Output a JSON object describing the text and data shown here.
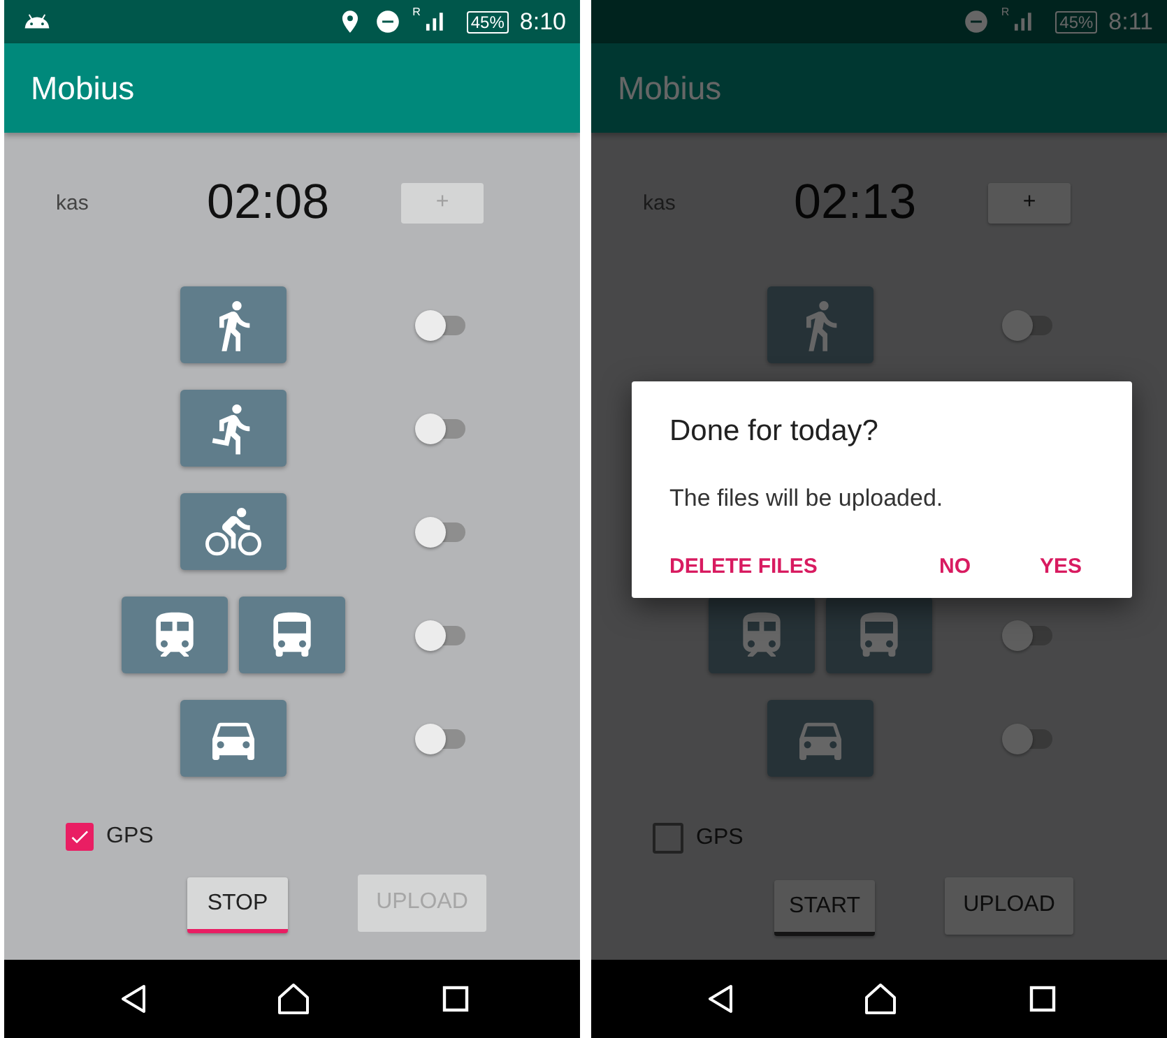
{
  "screens": [
    {
      "status_bar": {
        "left_icons": [
          {
            "kind": "android"
          }
        ],
        "right_icons": [
          {
            "kind": "location"
          },
          {
            "kind": "dnd"
          }
        ],
        "roaming": "R",
        "battery": "45%",
        "time": "8:10"
      },
      "app_title": "Mobius",
      "name_label": "kas",
      "timer": "02:08",
      "plus_button": {
        "label": "+",
        "disabled": true
      },
      "modes": [
        {
          "icons": [
            {
              "kind": "walk"
            }
          ],
          "on": false
        },
        {
          "icons": [
            {
              "kind": "run"
            }
          ],
          "on": false
        },
        {
          "icons": [
            {
              "kind": "bike"
            }
          ],
          "on": false
        },
        {
          "icons": [
            {
              "kind": "train"
            },
            {
              "kind": "bus"
            }
          ],
          "on": false
        },
        {
          "icons": [
            {
              "kind": "car"
            }
          ],
          "on": false
        }
      ],
      "gps": {
        "label": "GPS",
        "checked": true
      },
      "main_button": {
        "label": "STOP",
        "accent": true
      },
      "upload_button": {
        "label": "UPLOAD",
        "disabled": true
      }
    },
    {
      "status_bar": {
        "right_icons": [
          {
            "kind": "dnd"
          }
        ],
        "roaming": "R",
        "battery": "45%",
        "time": "8:11"
      },
      "app_title": "Mobius",
      "name_label": "kas",
      "timer": "02:13",
      "plus_button": {
        "label": "+",
        "disabled": false
      },
      "modes": [
        {
          "icons": [
            {
              "kind": "walk"
            }
          ],
          "on": false
        },
        {
          "icons": [
            {
              "kind": "train"
            },
            {
              "kind": "bus"
            }
          ],
          "on": false
        },
        {
          "icons": [
            {
              "kind": "car"
            }
          ],
          "on": false
        }
      ],
      "gps": {
        "label": "GPS",
        "checked": false
      },
      "main_button": {
        "label": "START",
        "accent": false
      },
      "upload_button": {
        "label": "UPLOAD",
        "disabled": false
      },
      "dialog": {
        "title": "Done for today?",
        "message": "The files will be uploaded.",
        "actions": [
          {
            "label": "DELETE FILES"
          },
          {
            "label": "NO"
          },
          {
            "label": "YES"
          }
        ]
      }
    }
  ]
}
